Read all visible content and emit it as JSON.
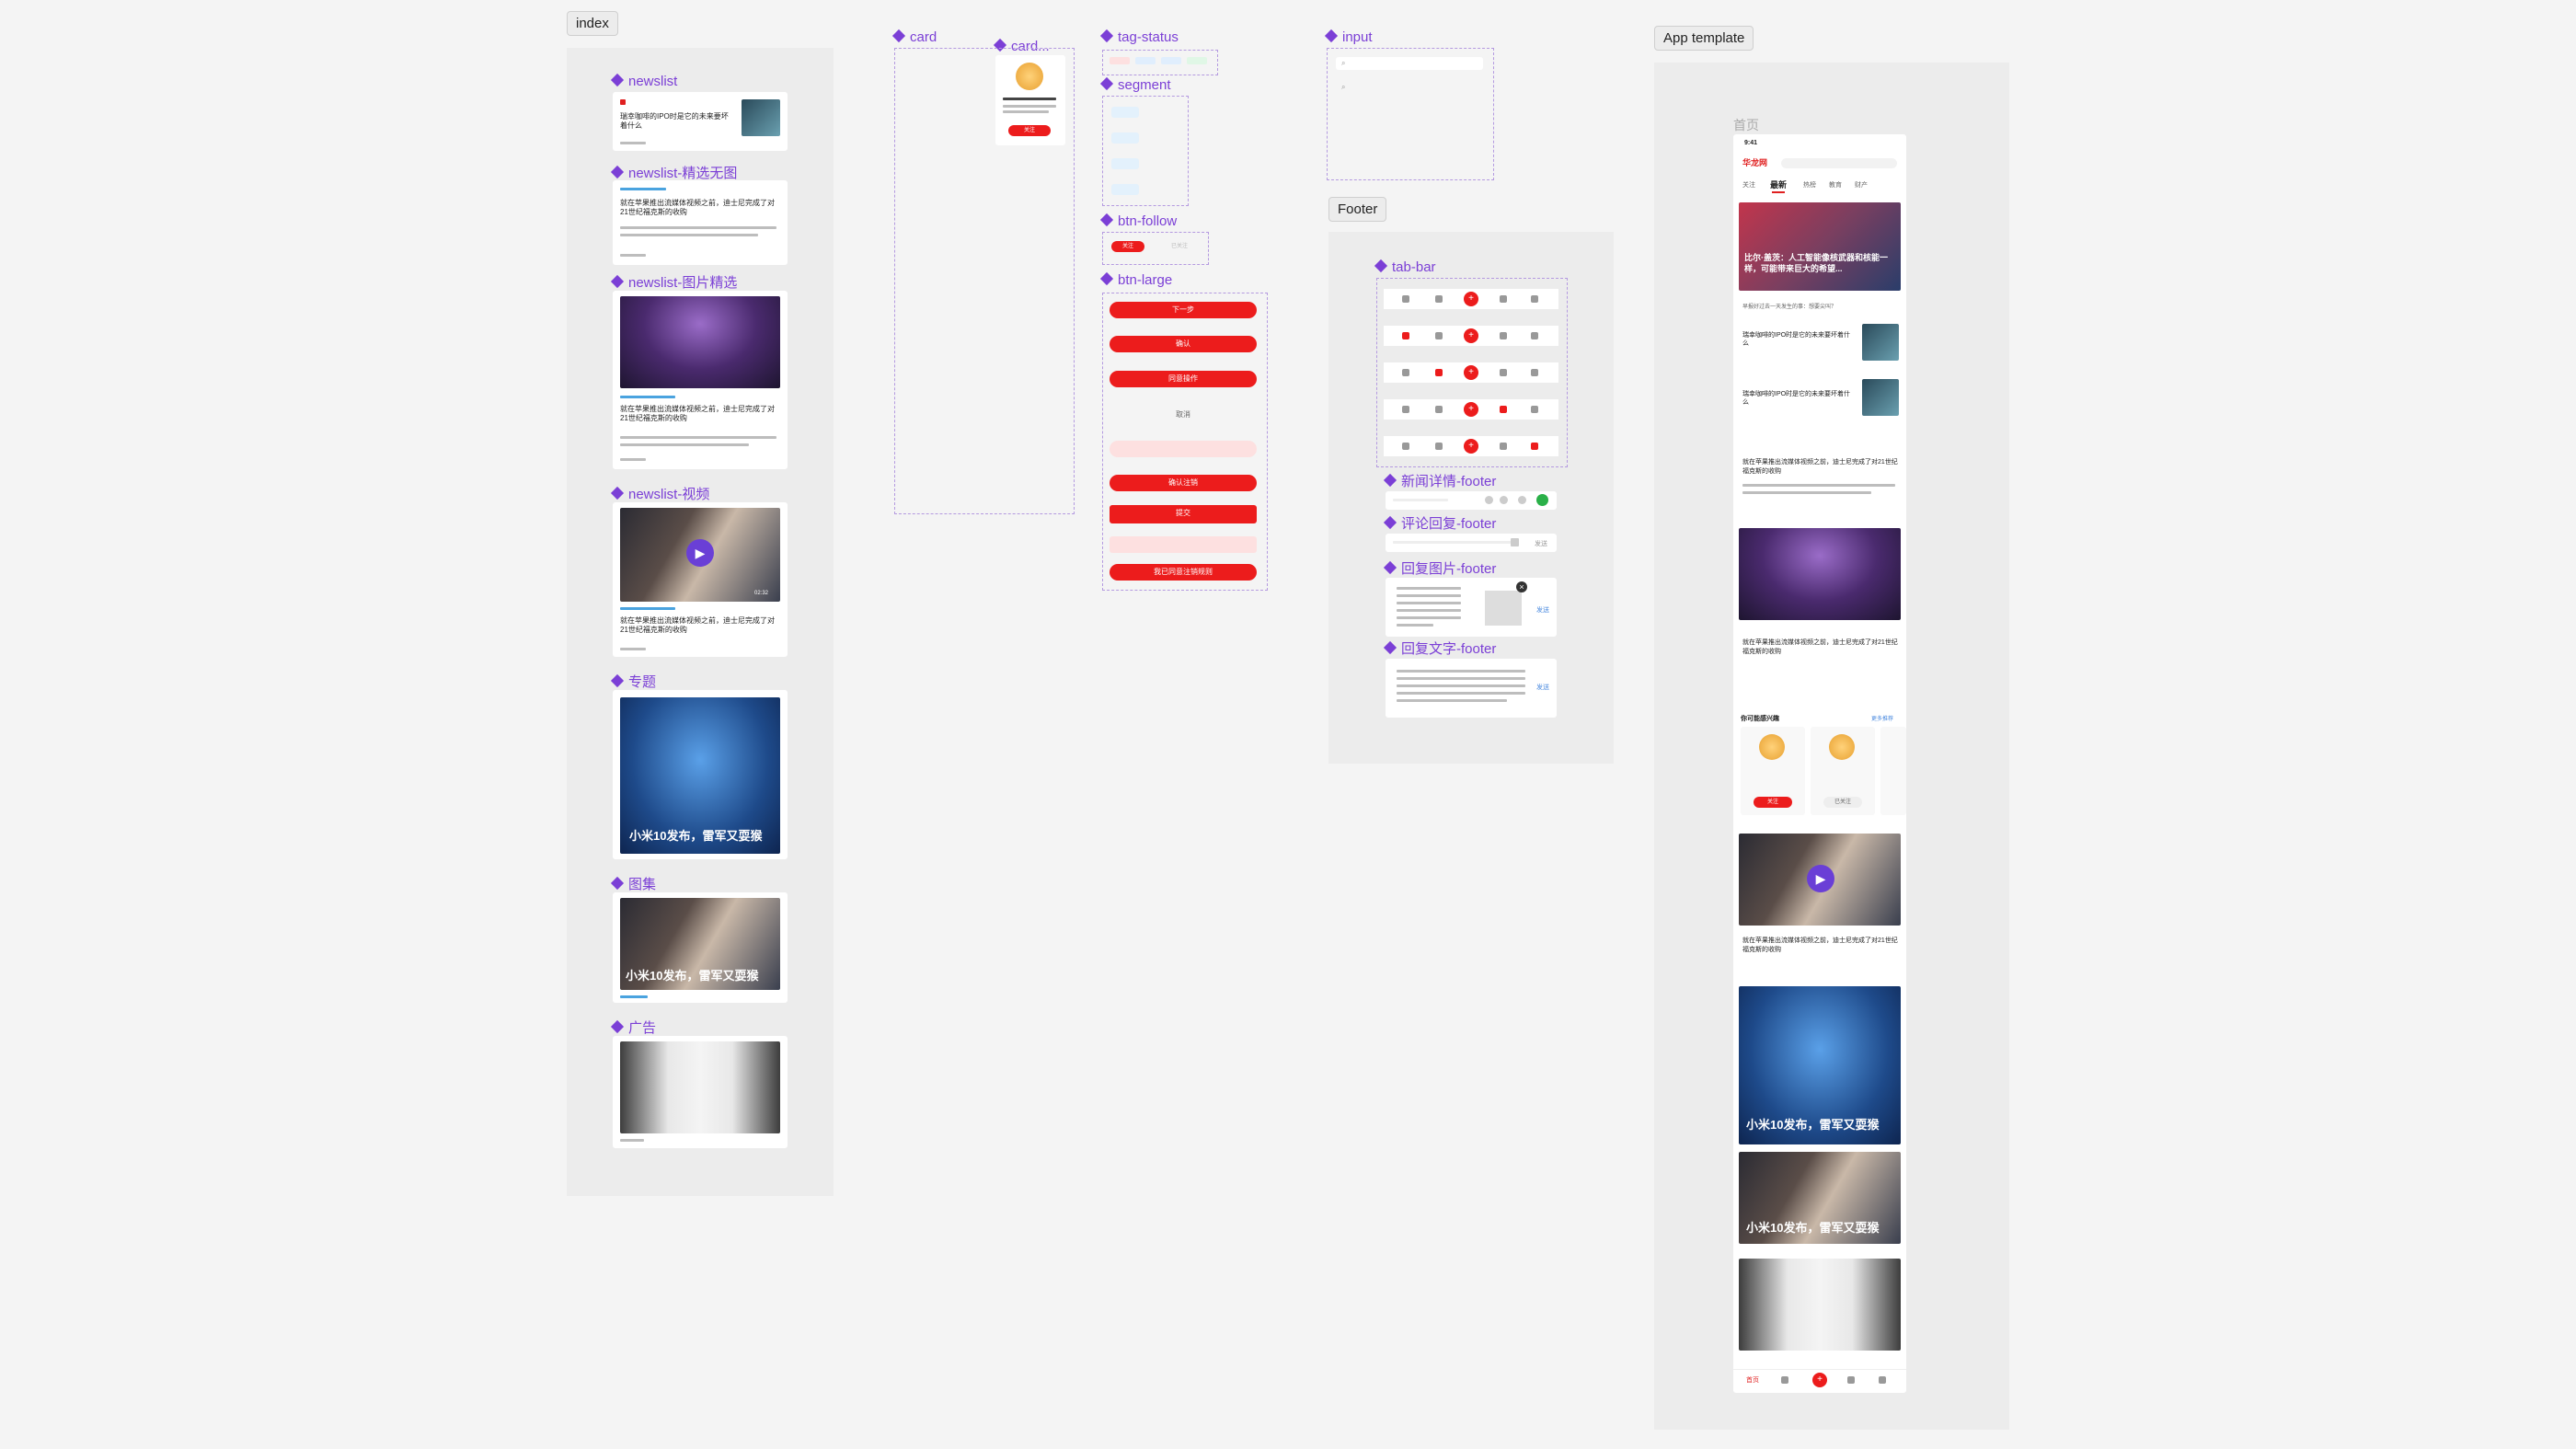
{
  "frames": {
    "index": "index",
    "footer": "Footer",
    "app_template": "App template"
  },
  "components": {
    "newslist": "newslist",
    "newslist_text": "newslist-精选无图",
    "newslist_image": "newslist-图片精选",
    "newslist_video": "newslist-视频",
    "topic": "专题",
    "gallery": "图集",
    "ad": "广告",
    "card": "card",
    "card_user": "card...",
    "tag_status": "tag-status",
    "segment": "segment",
    "btn_follow": "btn-follow",
    "btn_large": "btn-large",
    "input": "input",
    "tab_bar": "tab-bar",
    "news_footer": "新闻详情-footer",
    "comment_footer": "评论回复-footer",
    "reply_image_footer": "回复图片-footer",
    "reply_text_footer": "回复文字-footer"
  },
  "news": {
    "headline_short": "瑞幸咖啡的IPO时是它的未来要坏着什么",
    "headline_long": "就在苹果推出流媒体视频之前，迪士尼完成了对21世纪福克斯的收购",
    "topic_banner": "小米10发布，雷军又耍猴",
    "gallery_caption": "小米10发布，雷军又耍猴",
    "video_duration": "02:32"
  },
  "buttons": {
    "next": "下一步",
    "confirm": "确认",
    "agree": "同意操作",
    "cancel": "取消",
    "confirm_logout": "确认注销",
    "submit": "提交",
    "agree_logout": "我已同意注销规则",
    "follow": "关注",
    "followed": "已关注"
  },
  "app": {
    "page_label": "首页",
    "time": "9:41",
    "logo": "华龙网",
    "tabs": [
      "关注",
      "最新",
      "热榜",
      "教育",
      "财产"
    ],
    "hero_caption": "比尔·盖茨：人工智能像核武器和核能一样，可能带来巨大的希望...",
    "hot_line": "早报好过去一天发生的事：想要尖叫？",
    "recommend_title": "你可能感兴趣",
    "recommend_more": "更多推荐",
    "tab_items": [
      "首页",
      "",
      "",
      "",
      ""
    ]
  },
  "footer": {
    "send": "发送"
  }
}
